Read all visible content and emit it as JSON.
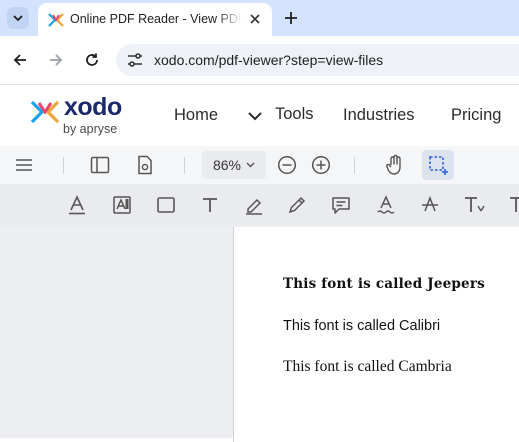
{
  "browser": {
    "tab_title": "Online PDF Reader - View PDFs",
    "url": "xodo.com/pdf-viewer?step=view-files"
  },
  "site": {
    "logo_word": "xodo",
    "logo_sub": "by apryse",
    "nav": [
      "Home",
      "Tools",
      "Industries",
      "Pricing"
    ]
  },
  "viewer": {
    "zoom": "86%",
    "document_lines": [
      "This font is called Jeepers",
      "This font is called Calibri",
      "This font is called Cambria"
    ]
  },
  "colors": {
    "tabbar": "#d3e3fd",
    "accent": "#2b5fd9",
    "logo_text": "#1b2a6b"
  }
}
